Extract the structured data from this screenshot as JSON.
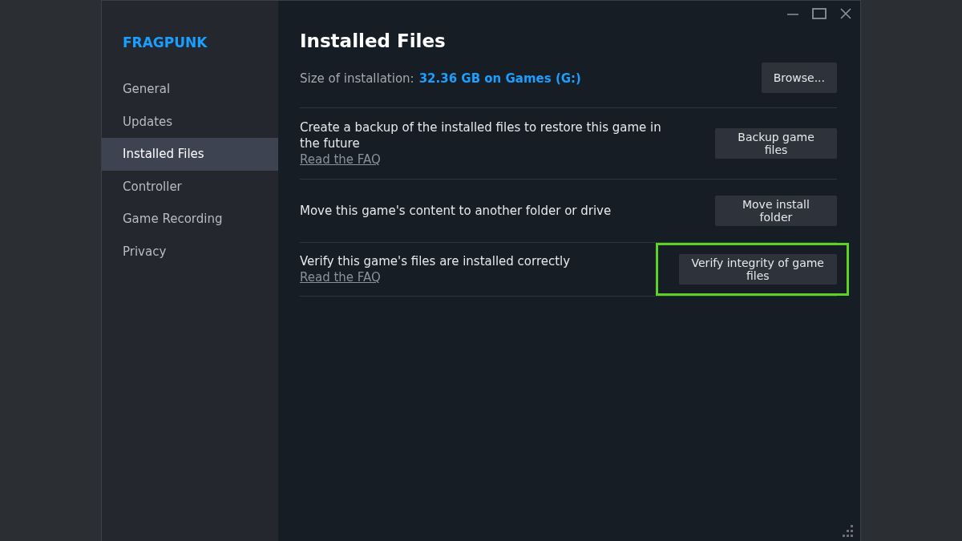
{
  "sidebar": {
    "title": "FRAGPUNK",
    "items": [
      {
        "label": "General",
        "selected": false
      },
      {
        "label": "Updates",
        "selected": false
      },
      {
        "label": "Installed Files",
        "selected": true
      },
      {
        "label": "Controller",
        "selected": false
      },
      {
        "label": "Game Recording",
        "selected": false
      },
      {
        "label": "Privacy",
        "selected": false
      }
    ]
  },
  "content": {
    "title": "Installed Files",
    "size": {
      "label": "Size of installation:",
      "value": "32.36 GB on Games (G:)",
      "button": "Browse..."
    },
    "rows": [
      {
        "text": "Create a backup of the installed files to restore this game in the future",
        "link": "Read the FAQ",
        "button": "Backup game files",
        "highlighted": false
      },
      {
        "text": "Move this game's content to another folder or drive",
        "button": "Move install folder",
        "highlighted": false
      },
      {
        "text": "Verify this game's files are installed correctly",
        "link": "Read the FAQ",
        "button": "Verify integrity of game files",
        "highlighted": true
      }
    ]
  }
}
